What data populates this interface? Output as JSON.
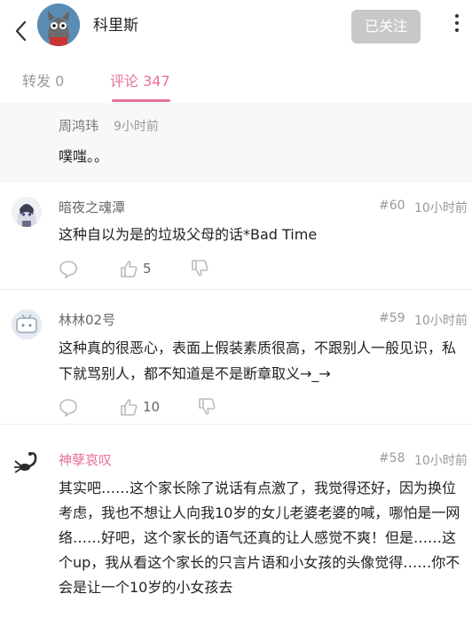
{
  "header": {
    "username": "科里斯",
    "follow_label": "已关注"
  },
  "tabs": {
    "repost": "转发 0",
    "comments": "评论 347"
  },
  "reply": {
    "author": "周鸿玮",
    "time": "9小时前",
    "text": "噗嗤。。"
  },
  "comments": [
    {
      "author": "暗夜之魂潭",
      "floor": "#60",
      "time": "10小时前",
      "text": "这种自以为是的垃圾父母的话*Bad Time",
      "likes": "5"
    },
    {
      "author": "林林02号",
      "floor": "#59",
      "time": "10小时前",
      "text": "这种真的很恶心，表面上假装素质很高，不跟别人一般见识，私下就骂别人，都不知道是不是断章取义→_→",
      "likes": "10"
    },
    {
      "author": "神孽哀叹",
      "floor": "#58",
      "time": "10小时前",
      "text": "其实吧……这个家长除了说话有点激了，我觉得还好，因为换位考虑，我也不想让人向我10岁的女儿老婆老婆的喊，哪怕是一网络……好吧，这个家长的语气还真的让人感觉不爽！但是……这个up，我从看这个家长的只言片语和小女孩的头像觉得……你不会是让一个10岁的小女孩去"
    }
  ],
  "colors": {
    "accent": "#e86f9c",
    "follow_bg": "#c8c8c8"
  }
}
